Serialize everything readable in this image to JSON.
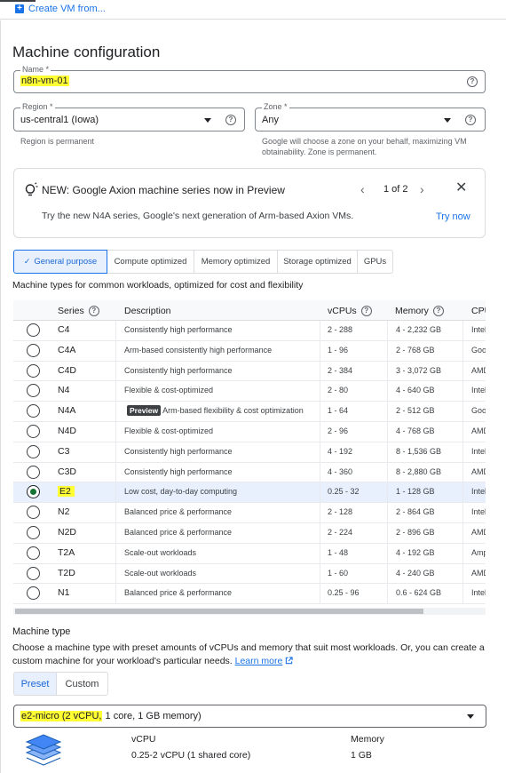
{
  "top": {
    "create_link": "Create VM from..."
  },
  "page": {
    "title": "Machine configuration"
  },
  "name_field": {
    "label": "Name *",
    "value": "n8n-vm-01"
  },
  "region": {
    "label": "Region *",
    "value": "us-central1 (Iowa)",
    "hint": "Region is permanent"
  },
  "zone": {
    "label": "Zone *",
    "value": "Any",
    "hint_line1": "Google will choose a zone on your behalf, maximizing VM",
    "hint_line2": "obtainability. Zone is permanent."
  },
  "banner": {
    "title": "NEW: Google Axion machine series now in Preview",
    "body": "Try the new N4A series, Google's next generation of Arm-based Axion VMs.",
    "pager": "1 of 2",
    "action": "Try now"
  },
  "tabs": [
    "General purpose",
    "Compute optimized",
    "Memory optimized",
    "Storage optimized",
    "GPUs"
  ],
  "tab_check": "✓",
  "subtitle": "Machine types for common workloads, optimized for cost and flexibility",
  "table": {
    "headers": {
      "series": "Series",
      "description": "Description",
      "vcpus": "vCPUs",
      "memory": "Memory",
      "cpu": "CPU"
    },
    "rows": [
      {
        "series": "C4",
        "description": "Consistently high performance",
        "vcpus": "2 - 288",
        "memory": "4 - 2,232 GB",
        "cpu": "Intel"
      },
      {
        "series": "C4A",
        "description": "Arm-based consistently high performance",
        "vcpus": "1 - 96",
        "memory": "2 - 768 GB",
        "cpu": "Goo"
      },
      {
        "series": "C4D",
        "description": "Consistently high performance",
        "vcpus": "2 - 384",
        "memory": "3 - 3,072 GB",
        "cpu": "AMD"
      },
      {
        "series": "N4",
        "description": "Flexible & cost-optimized",
        "vcpus": "2 - 80",
        "memory": "4 - 640 GB",
        "cpu": "Intel"
      },
      {
        "series": "N4A",
        "badge": "Preview",
        "description": "Arm-based flexibility & cost optimization",
        "vcpus": "1 - 64",
        "memory": "2 - 512 GB",
        "cpu": "Goo"
      },
      {
        "series": "N4D",
        "description": "Flexible & cost-optimized",
        "vcpus": "2 - 96",
        "memory": "4 - 768 GB",
        "cpu": "AMD"
      },
      {
        "series": "C3",
        "description": "Consistently high performance",
        "vcpus": "4 - 192",
        "memory": "8 - 1,536 GB",
        "cpu": "Intel"
      },
      {
        "series": "C3D",
        "description": "Consistently high performance",
        "vcpus": "4 - 360",
        "memory": "8 - 2,880 GB",
        "cpu": "AMD"
      },
      {
        "series": "E2",
        "selected": true,
        "description": "Low cost, day-to-day computing",
        "vcpus": "0.25 - 32",
        "memory": "1 - 128 GB",
        "cpu": "Intel"
      },
      {
        "series": "N2",
        "description": "Balanced price & performance",
        "vcpus": "2 - 128",
        "memory": "2 - 864 GB",
        "cpu": "Intel"
      },
      {
        "series": "N2D",
        "description": "Balanced price & performance",
        "vcpus": "2 - 224",
        "memory": "2 - 896 GB",
        "cpu": "AMD"
      },
      {
        "series": "T2A",
        "description": "Scale-out workloads",
        "vcpus": "1 - 48",
        "memory": "4 - 192 GB",
        "cpu": "Amp"
      },
      {
        "series": "T2D",
        "description": "Scale-out workloads",
        "vcpus": "1 - 60",
        "memory": "4 - 240 GB",
        "cpu": "AMD"
      },
      {
        "series": "N1",
        "description": "Balanced price & performance",
        "vcpus": "0.25 - 96",
        "memory": "0.6 - 624 GB",
        "cpu": "Intel"
      }
    ]
  },
  "machine_type": {
    "title": "Machine type",
    "desc_line1": "Choose a machine type with preset amounts of vCPUs and memory that suit most workloads. Or, you can create a",
    "desc_line2": "custom machine for your workload's particular needs.",
    "learn_more": "Learn more",
    "toggle_preset": "Preset",
    "toggle_custom": "Custom",
    "select_prefix": "e2-micro (2 vCPU,",
    "select_suffix": " 1 core, 1 GB memory)",
    "vcpu_label": "vCPU",
    "vcpu_value": "0.25-2 vCPU (1 shared core)",
    "memory_label": "Memory",
    "memory_value": "1 GB"
  },
  "colors": {
    "accent": "#1a73e8",
    "highlight": "#ffff33",
    "selected_row": "#e8f0fe"
  },
  "icons": [
    "plus-square-icon",
    "help-icon",
    "dropdown-caret-icon",
    "lightbulb-icon",
    "chevron-left-icon",
    "chevron-right-icon",
    "close-icon",
    "check-icon",
    "external-link-icon",
    "stack-icon"
  ]
}
